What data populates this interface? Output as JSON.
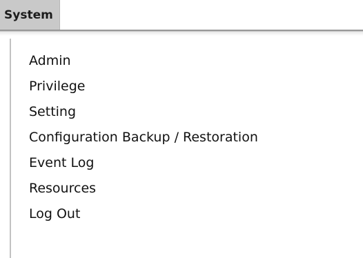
{
  "menu": {
    "title": "System",
    "items": [
      {
        "label": "Admin"
      },
      {
        "label": "Privilege"
      },
      {
        "label": "Setting"
      },
      {
        "label": "Configuration Backup / Restoration"
      },
      {
        "label": "Event Log"
      },
      {
        "label": "Resources"
      },
      {
        "label": "Log Out"
      }
    ]
  }
}
